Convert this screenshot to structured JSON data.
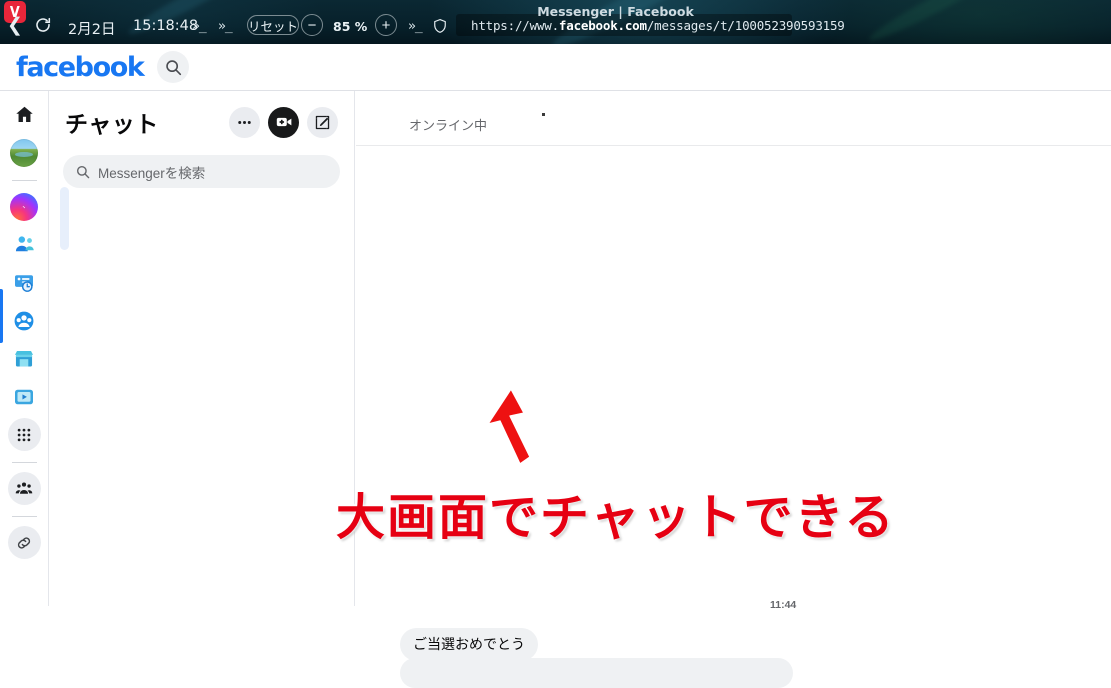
{
  "browser": {
    "logo_icon": "vivaldi-logo",
    "back_icon": "back-arrow-icon",
    "reload_icon": "reload-icon",
    "date": "2月2日",
    "time": "15:18:48",
    "chevron_icon": "double-chevron-terminal-icon",
    "zoom_reset_label": "リセット",
    "zoom_out_label": "−",
    "zoom_level": "85 %",
    "zoom_in_label": "+",
    "shield_icon": "shield-icon",
    "lock_icon": "lock-icon",
    "url_scheme": "https://www.",
    "url_host": "facebook.com",
    "url_path": "/messages/t/100052390593159",
    "window_title": "Messenger | Facebook"
  },
  "fb_header": {
    "logo_text": "facebook",
    "search_icon": "search-icon",
    "brand_color": "#1877f2"
  },
  "nav_rail": {
    "items": [
      {
        "name": "home",
        "icon": "home-icon"
      },
      {
        "name": "profile",
        "icon": "avatar-photo-icon"
      },
      {
        "name": "messenger",
        "icon": "messenger-logo-icon",
        "active": true
      },
      {
        "name": "friends",
        "icon": "friends-icon"
      },
      {
        "name": "memories",
        "icon": "memories-clock-icon"
      },
      {
        "name": "groups",
        "icon": "groups-icon"
      },
      {
        "name": "marketplace",
        "icon": "marketplace-store-icon"
      },
      {
        "name": "watch",
        "icon": "video-play-icon"
      },
      {
        "name": "all-shortcuts",
        "icon": "grid-dots-icon"
      },
      {
        "name": "people-group",
        "icon": "people-group-icon"
      },
      {
        "name": "link",
        "icon": "chain-link-icon"
      }
    ],
    "active_indicator_color": "#1877f2"
  },
  "chat_panel": {
    "title": "チャット",
    "menu_icon": "ellipsis-icon",
    "video_call_icon": "video-camera-plus-icon",
    "compose_icon": "compose-pencil-icon",
    "search_icon": "search-icon",
    "search_placeholder": "Messengerを検索",
    "search_value": ""
  },
  "conversation": {
    "status": "オンライン中",
    "timestamp": "11:44",
    "messages": [
      {
        "text": "ご当選おめでとう",
        "side": "incoming"
      }
    ]
  },
  "annotation": {
    "text": "大画面でチャットできる",
    "color": "#e60012",
    "arrow_icon": "red-arrow-up-icon"
  }
}
